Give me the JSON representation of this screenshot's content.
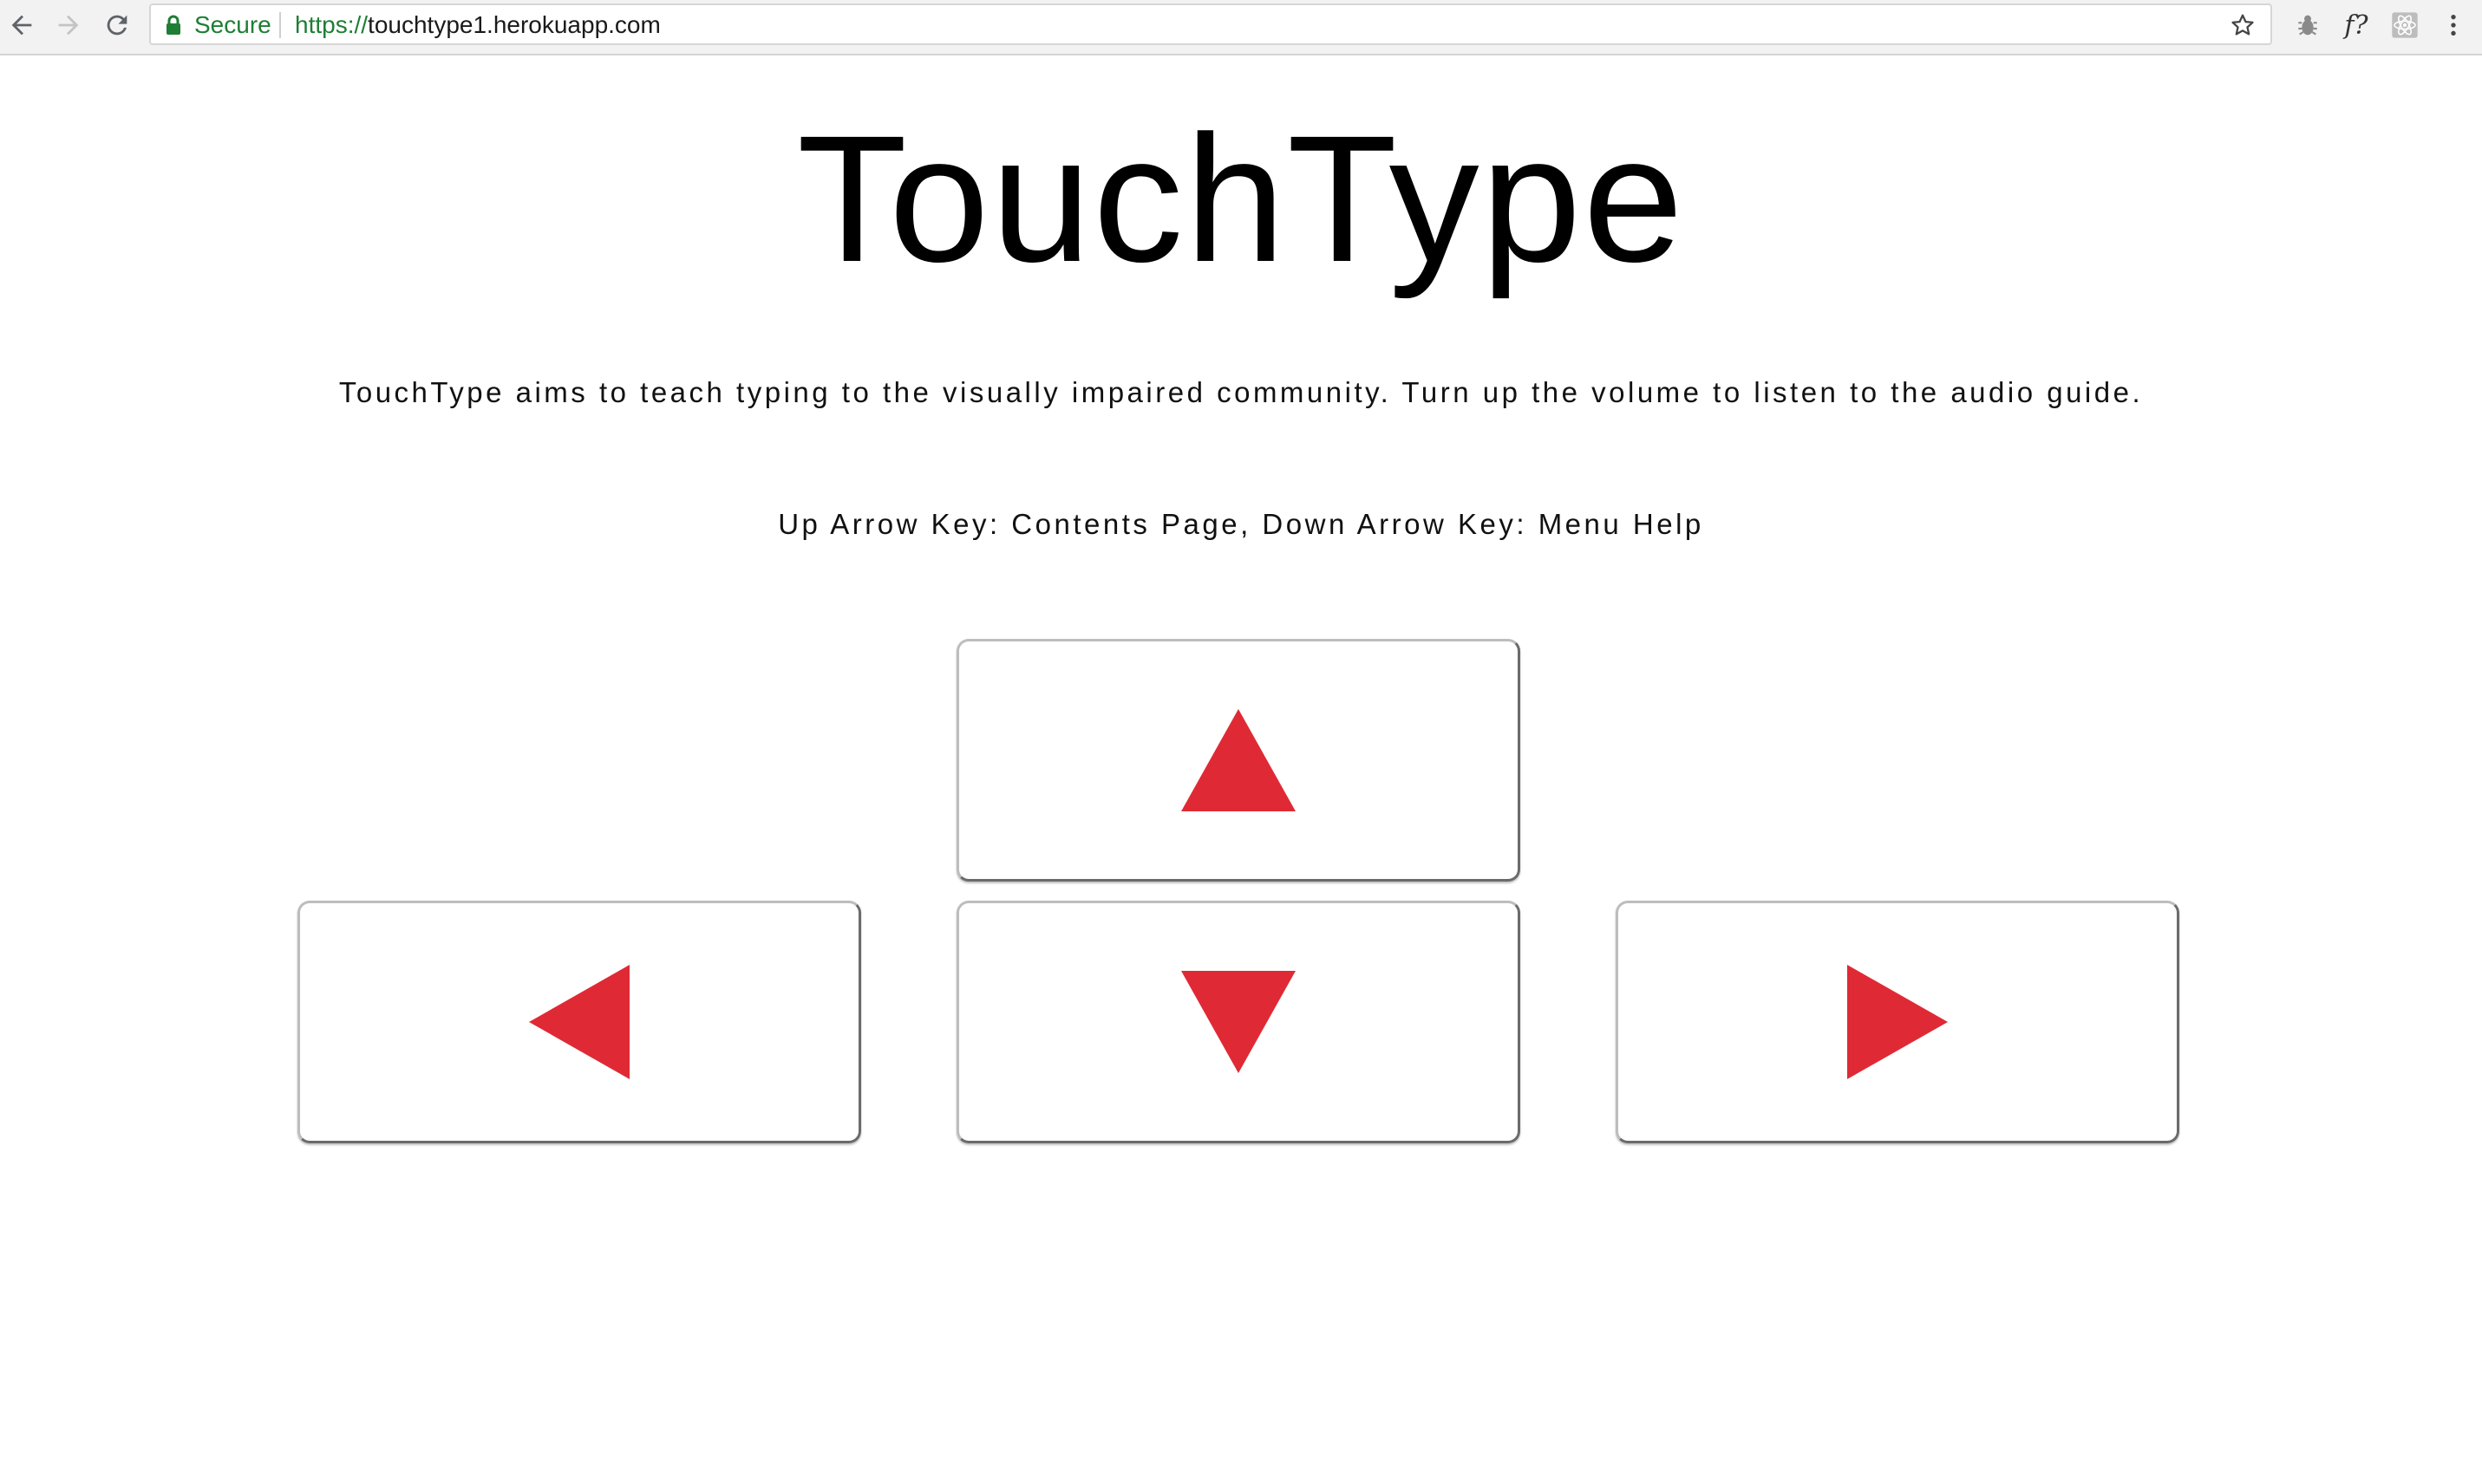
{
  "browser": {
    "secure_label": "Secure",
    "url_scheme": "https://",
    "url_host": "touchtype1.herokuapp.com",
    "extension_f_label": "f?"
  },
  "page": {
    "title": "TouchType",
    "intro": "TouchType aims to teach typing to the visually impaired community. Turn up the volume to listen to the audio guide.",
    "hint": "Up Arrow Key: Contents Page, Down Arrow Key: Menu Help"
  },
  "colors": {
    "arrow": "#df2a35",
    "secure_green": "#1e7e34"
  },
  "keys": [
    {
      "id": "up",
      "icon": "arrow-up-icon"
    },
    {
      "id": "left",
      "icon": "arrow-left-icon"
    },
    {
      "id": "down",
      "icon": "arrow-down-icon"
    },
    {
      "id": "right",
      "icon": "arrow-right-icon"
    }
  ]
}
